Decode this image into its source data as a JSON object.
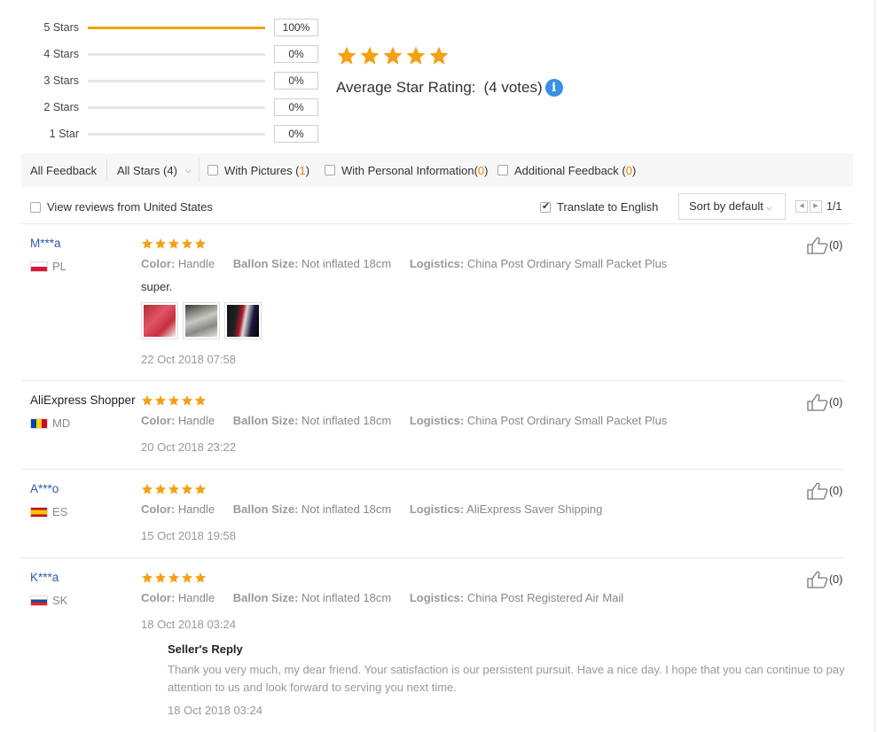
{
  "histogram": [
    {
      "label": "5 Stars",
      "percent": "100%",
      "fill": 1.0
    },
    {
      "label": "4 Stars",
      "percent": "0%",
      "fill": 0
    },
    {
      "label": "3 Stars",
      "percent": "0%",
      "fill": 0
    },
    {
      "label": "2 Stars",
      "percent": "0%",
      "fill": 0
    },
    {
      "label": "1 Star",
      "percent": "0%",
      "fill": 0
    }
  ],
  "summary": {
    "stars": 5,
    "avg_label": "Average Star Rating:",
    "votes": "(4 votes)",
    "info_icon": "info-icon"
  },
  "filters": {
    "all_feedback": "All Feedback",
    "all_stars": "All Stars (4)",
    "with_pictures": "With Pictures (",
    "with_pictures_count": "1",
    "with_personal": "With Personal Information(",
    "with_personal_count": "0",
    "additional": "Additional Feedback (",
    "additional_count": "0",
    "close_paren": ")"
  },
  "options": {
    "view_us": "View reviews from United States",
    "translate": "Translate to English",
    "sort": "Sort by default",
    "page": "1/1"
  },
  "labels": {
    "color": "Color:",
    "size": "Ballon Size:",
    "logistics": "Logistics:"
  },
  "reviews": [
    {
      "name": "M***a",
      "country": "PL",
      "stars": 5,
      "color": "Handle",
      "size": "Not inflated 18cm",
      "logistics": "China Post Ordinary Small Packet Plus",
      "text": "super.",
      "date": "22 Oct 2018 07:58",
      "likes": "(0)",
      "photos": 3
    },
    {
      "name": "AliExpress Shopper",
      "country": "MD",
      "stars": 5,
      "color": "Handle",
      "size": "Not inflated 18cm",
      "logistics": "China Post Ordinary Small Packet Plus",
      "date": "20 Oct 2018 23:22",
      "likes": "(0)"
    },
    {
      "name": "A***o",
      "country": "ES",
      "stars": 5,
      "color": "Handle",
      "size": "Not inflated 18cm",
      "logistics": "AliExpress Saver Shipping",
      "date": "15 Oct 2018 19:58",
      "likes": "(0)"
    },
    {
      "name": "K***a",
      "country": "SK",
      "stars": 5,
      "color": "Handle",
      "size": "Not inflated 18cm",
      "logistics": "China Post Registered Air Mail",
      "date": "18 Oct 2018 03:24",
      "likes": "(0)",
      "reply": {
        "title": "Seller's Reply",
        "text": "Thank you very much, my dear friend. Your satisfaction is our persistent pursuit. Have a nice day. I hope that you can continue to pay attention to us and look forward to serving you next time.",
        "date": "18 Oct 2018 03:24"
      }
    }
  ],
  "colors": {
    "star": "#f5a013",
    "bar": "#f0a30a",
    "link": "#2e5aa8",
    "count": "#f08200"
  }
}
